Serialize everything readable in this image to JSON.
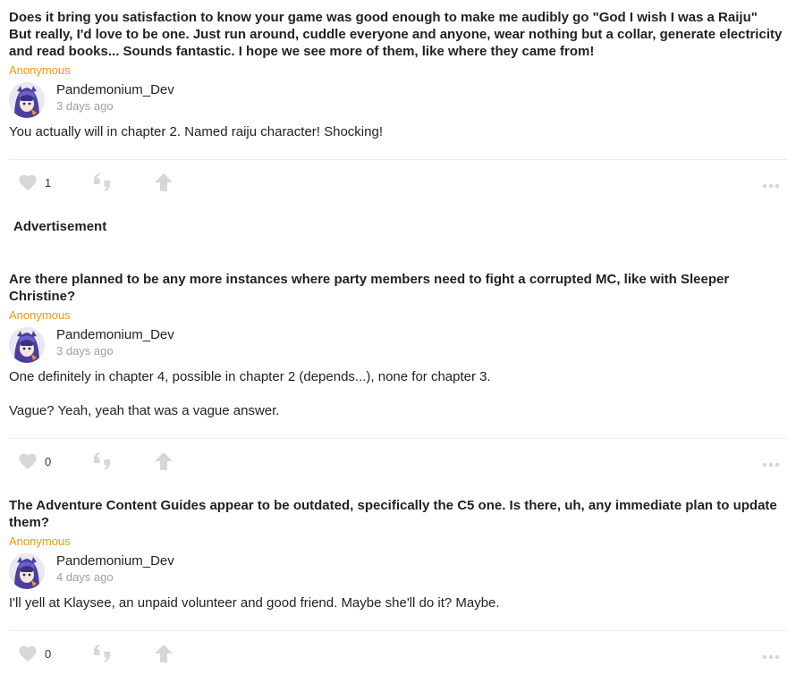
{
  "colors": {
    "asker": "#f0980f",
    "time": "#a0a0a0",
    "icon": "#d7d7d7"
  },
  "advertisement_label": "Advertisement",
  "posts": [
    {
      "question": "Does it bring you satisfaction to know your game was good enough to make me audibly go \"God I wish I was a Raiju\"\nBut really, I'd love to be one. Just run around, cuddle everyone and anyone, wear nothing but a collar, generate electricity and read books... Sounds fantastic. I hope we see more of them, like where they came from!",
      "asker": "Anonymous",
      "author": "Pandemonium_Dev",
      "time": "3 days ago",
      "answer": [
        "You actually will in chapter 2. Named raiju character! Shocking!"
      ],
      "likes": "1"
    },
    {
      "question": "Are there planned to be any more instances where party members need to fight a corrupted MC, like with Sleeper Christine?",
      "asker": "Anonymous",
      "author": "Pandemonium_Dev",
      "time": "3 days ago",
      "answer": [
        "One definitely in chapter 4, possible in chapter 2 (depends...), none for chapter 3.",
        "Vague? Yeah, yeah that was a vague answer."
      ],
      "likes": "0"
    },
    {
      "question": "The Adventure Content Guides appear to be outdated, specifically the C5 one. Is there, uh, any immediate plan to update them?",
      "asker": "Anonymous",
      "author": "Pandemonium_Dev",
      "time": "4 days ago",
      "answer": [
        "I'll yell at Klaysee, an unpaid volunteer and good friend. Maybe she'll do it? Maybe."
      ],
      "likes": "0"
    }
  ],
  "icons": {
    "like": "heart-icon",
    "quote": "quote-icon",
    "share": "share-arrow-icon",
    "more": "more-dots-icon",
    "avatar": "avatar-image"
  }
}
